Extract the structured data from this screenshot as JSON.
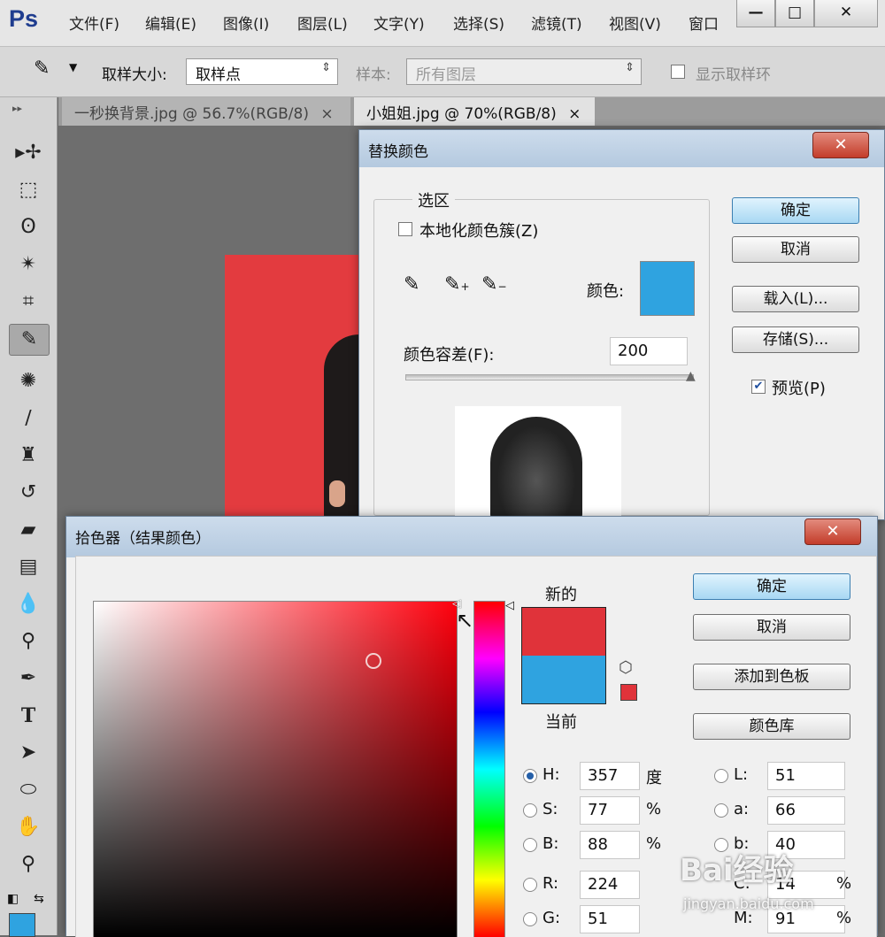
{
  "app": {
    "logo": "Ps"
  },
  "menu": [
    "文件(F)",
    "编辑(E)",
    "图像(I)",
    "图层(L)",
    "文字(Y)",
    "选择(S)",
    "滤镜(T)",
    "视图(V)",
    "窗口"
  ],
  "window_controls": [
    "—",
    "□",
    "✕"
  ],
  "options": {
    "sample_size_label": "取样大小:",
    "sample_size_value": "取样点",
    "sample_label": "样本:",
    "sample_value": "所有图层",
    "show_ring_label": "显示取样环"
  },
  "tabs": [
    {
      "label": "一秒换背景.jpg @ 56.7%(RGB/8)",
      "close": "×",
      "active": false
    },
    {
      "label": "小姐姐.jpg @ 70%(RGB/8)",
      "close": "×",
      "active": true
    }
  ],
  "tools": [
    "move-tool",
    "marquee-tool",
    "lasso-tool",
    "magic-wand-tool",
    "crop-tool",
    "eyedropper-tool",
    "healing-tool",
    "brush-tool",
    "stamp-tool",
    "history-brush-tool",
    "eraser-tool",
    "gradient-tool",
    "blur-tool",
    "dodge-tool",
    "pen-tool",
    "type-tool",
    "path-selection-tool",
    "shape-tool",
    "hand-tool",
    "zoom-tool"
  ],
  "replace_dialog": {
    "title": "替换颜色",
    "close": "✕",
    "selection_group": "选区",
    "localized_label": "本地化颜色簇(Z)",
    "color_label": "颜色:",
    "color_swatch": "#2fa3e0",
    "tolerance_label": "颜色容差(F):",
    "tolerance_value": "200",
    "tolerance_fraction": 1.0,
    "ok": "确定",
    "cancel": "取消",
    "load": "载入(L)...",
    "save": "存储(S)...",
    "preview_label": "预览(P)",
    "preview_checked": true
  },
  "picker_dialog": {
    "title": "拾色器（结果颜色）",
    "close": "✕",
    "new_label": "新的",
    "current_label": "当前",
    "new_color": "#e0333a",
    "current_color": "#2fa3e0",
    "ok": "确定",
    "cancel": "取消",
    "add_swatch": "添加到色板",
    "color_library": "颜色库",
    "fields": {
      "H": {
        "label": "H:",
        "value": "357",
        "unit": "度"
      },
      "S": {
        "label": "S:",
        "value": "77",
        "unit": "%"
      },
      "B": {
        "label": "B:",
        "value": "88",
        "unit": "%"
      },
      "R": {
        "label": "R:",
        "value": "224"
      },
      "G": {
        "label": "G:",
        "value": "51"
      },
      "L": {
        "label": "L:",
        "value": "51"
      },
      "a": {
        "label": "a:",
        "value": "66"
      },
      "b": {
        "label": "b:",
        "value": "40"
      },
      "C": {
        "label": "C:",
        "value": "14",
        "unit": "%"
      },
      "M": {
        "label": "M:",
        "value": "91",
        "unit": "%"
      }
    }
  },
  "watermark": {
    "brand": "Bai经验",
    "url": "jingyan.baidu.com"
  }
}
